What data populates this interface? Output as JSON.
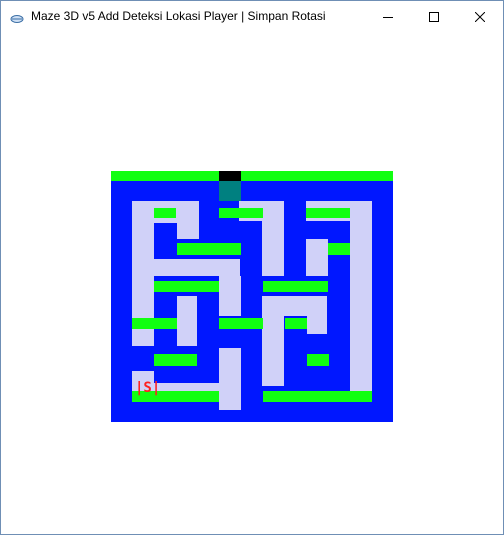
{
  "window": {
    "title": "Maze 3D v5 Add Deteksi Lokasi Player | Simpan Rotasi",
    "controls": [
      "minimize",
      "maximize",
      "close"
    ]
  },
  "maze": {
    "player_marker": "|S|",
    "colors": {
      "wall": "#0017ff",
      "path": "#d0d1f8",
      "green_wall": "#11ff11",
      "entrance": "#000000",
      "entrance_path": "#008080",
      "player": "#ff2020"
    }
  }
}
